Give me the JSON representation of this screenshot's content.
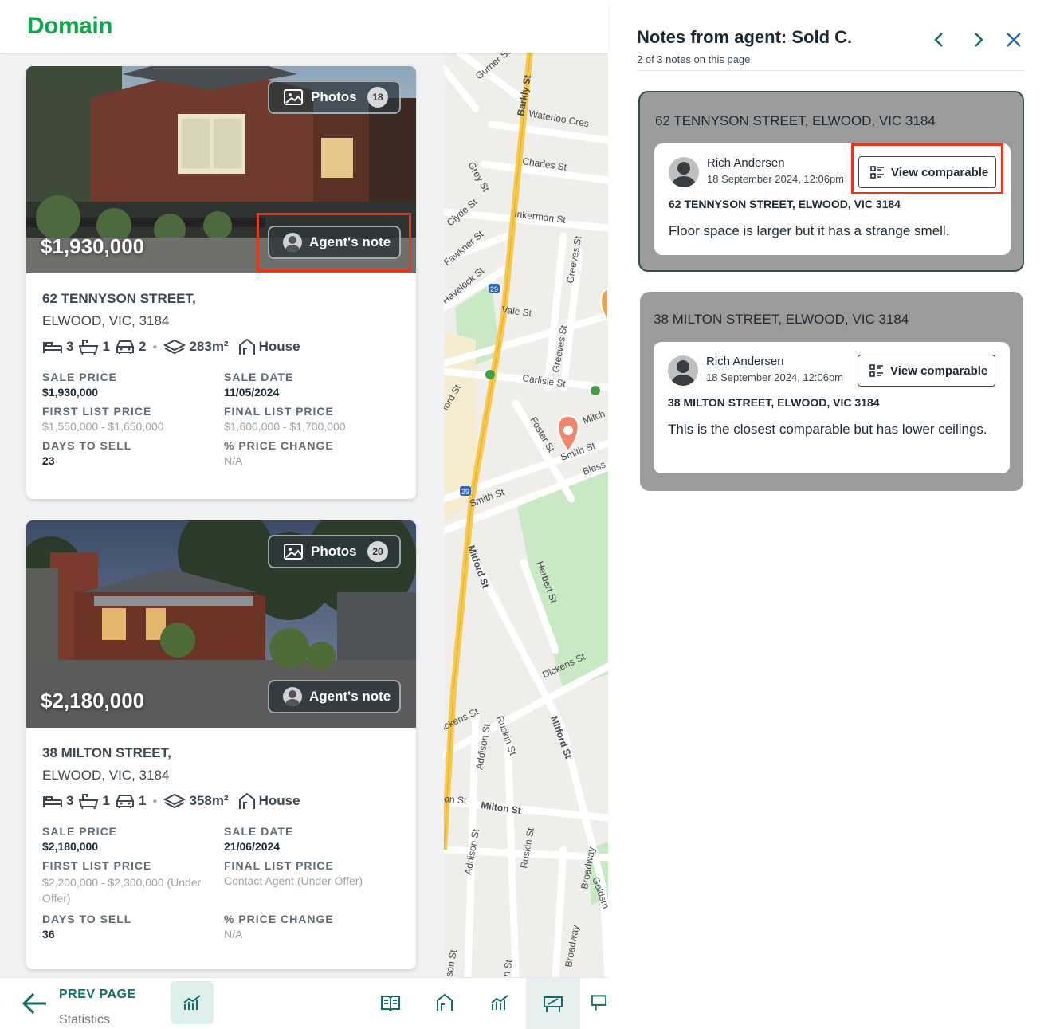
{
  "header": {
    "logo": "Domain"
  },
  "listings": [
    {
      "price": "$1,930,000",
      "photos_label": "Photos",
      "photos_count": "18",
      "agent_note_label": "Agent's note",
      "address_line1": "62 TENNYSON STREET,",
      "address_line2": "ELWOOD, VIC, 3184",
      "beds": "3",
      "baths": "1",
      "cars": "2",
      "land": "283m²",
      "type": "House",
      "stats": {
        "sale_price_label": "SALE PRICE",
        "sale_price": "$1,930,000",
        "sale_date_label": "SALE DATE",
        "sale_date": "11/05/2024",
        "first_list_label": "FIRST LIST PRICE",
        "first_list": "$1,550,000 - $1,650,000",
        "final_list_label": "FINAL LIST PRICE",
        "final_list": "$1,600,000 - $1,700,000",
        "days_label": "DAYS TO SELL",
        "days": "23",
        "change_label": "% PRICE CHANGE",
        "change": "N/A"
      }
    },
    {
      "price": "$2,180,000",
      "photos_label": "Photos",
      "photos_count": "20",
      "agent_note_label": "Agent's note",
      "address_line1": "38 MILTON STREET,",
      "address_line2": "ELWOOD, VIC, 3184",
      "beds": "3",
      "baths": "1",
      "cars": "1",
      "land": "358m²",
      "type": "House",
      "stats": {
        "sale_price_label": "SALE PRICE",
        "sale_price": "$2,180,000",
        "sale_date_label": "SALE DATE",
        "sale_date": "21/06/2024",
        "first_list_label": "FIRST LIST PRICE",
        "first_list": "$2,200,000 - $2,300,000 (Under Offer)",
        "final_list_label": "FINAL LIST PRICE",
        "final_list": "Contact Agent (Under Offer)",
        "days_label": "DAYS TO SELL",
        "days": "36",
        "change_label": "% PRICE CHANGE",
        "change": "N/A"
      }
    }
  ],
  "map": {
    "streets": [
      "Gurner St",
      "Barkly St",
      "Waterloo Cres",
      "Charles St",
      "Grey St",
      "Clyde St",
      "Inkerman St",
      "Fawkner St",
      "Greeves St",
      "Havelock St",
      "Vale St",
      "Greeves St",
      "Carlisle St",
      "ford St",
      "Foster St",
      "Mitch",
      "Smith St",
      "Bless",
      "Smith St",
      "Mitford St",
      "Herbert St",
      "Dickens St",
      "ickens St",
      "Addison St",
      "Ruskin St",
      "Mitford St",
      "on St",
      "Milton St",
      "Addison St",
      "Ruskin St",
      "Broadway",
      "Goldsm",
      "Broadway",
      "son St",
      "n St"
    ],
    "route_shield": "29"
  },
  "bottom_nav": {
    "prev_label": "PREV PAGE",
    "prev_sub": "Statistics"
  },
  "panel": {
    "title": "Notes from agent: Sold C.",
    "subtitle": "2 of 3 notes on this page",
    "notes": [
      {
        "heading": "62 TENNYSON STREET, ELWOOD, VIC 3184",
        "author": "Rich Andersen",
        "date": "18 September 2024, 12:06pm",
        "button": "View comparable",
        "address": "62 TENNYSON STREET, ELWOOD, VIC 3184",
        "text": "Floor space is larger but it has a strange smell."
      },
      {
        "heading": "38 MILTON STREET, ELWOOD, VIC 3184",
        "author": "Rich Andersen",
        "date": "18 September 2024, 12:06pm",
        "button": "View comparable",
        "address": "38 MILTON STREET, ELWOOD, VIC 3184",
        "text": "This is the closest comparable but has lower ceilings."
      }
    ]
  },
  "colors": {
    "brand": "#0ea84a",
    "accent": "#0f6f68",
    "highlight": "#e8361a"
  }
}
